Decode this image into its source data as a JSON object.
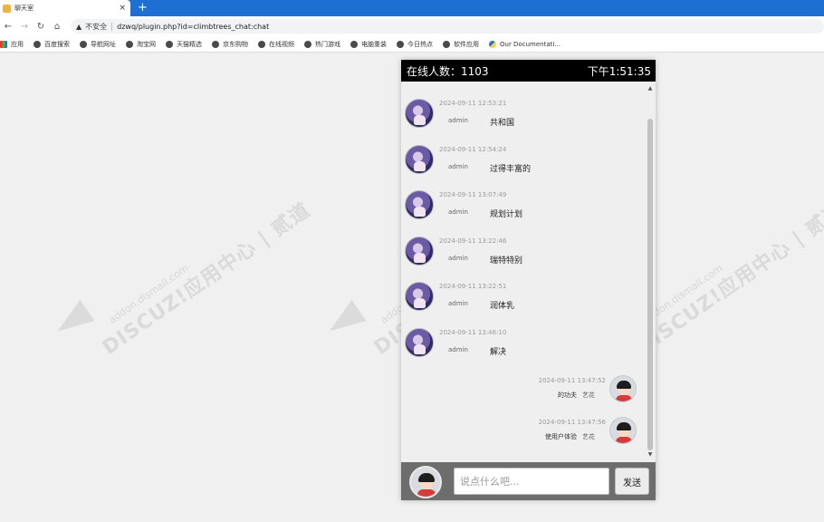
{
  "browser": {
    "tab_title": "聊天室",
    "tab_close": "×",
    "new_tab": "+",
    "back": "←",
    "forward": "→",
    "reload": "↻",
    "home": "⌂",
    "insecure_label": "不安全",
    "url": "dzwq/plugin.php?id=climbtrees_chat:chat",
    "bookmarks": [
      {
        "label": "应用",
        "icon": "apps-icon"
      },
      {
        "label": "百度搜索",
        "icon": "globe-icon"
      },
      {
        "label": "导航网址",
        "icon": "globe-icon"
      },
      {
        "label": "淘宝网",
        "icon": "globe-icon"
      },
      {
        "label": "天猫精选",
        "icon": "globe-icon"
      },
      {
        "label": "京东购物",
        "icon": "globe-icon"
      },
      {
        "label": "在线视频",
        "icon": "globe-icon"
      },
      {
        "label": "热门游戏",
        "icon": "globe-icon"
      },
      {
        "label": "电脑重装",
        "icon": "globe-icon"
      },
      {
        "label": "今日热点",
        "icon": "globe-icon"
      },
      {
        "label": "软件应用",
        "icon": "globe-icon"
      },
      {
        "label": "Our Documentati...",
        "icon": "python-icon"
      }
    ]
  },
  "watermark": {
    "brand": "DISCUZ!应用中心 | 贰道",
    "site": "addon.dismall.com"
  },
  "chat": {
    "online_label": "在线人数：1103",
    "clock": "下午1:51:35",
    "messages_in": [
      {
        "time": "2024-09-11 12:53:21",
        "name": "admin",
        "text": "共和国"
      },
      {
        "time": "2024-09-11 12:54:24",
        "name": "admin",
        "text": "过得丰富的"
      },
      {
        "time": "2024-09-11 13:07:49",
        "name": "admin",
        "text": "规划计划"
      },
      {
        "time": "2024-09-11 13:22:46",
        "name": "admin",
        "text": "瑞特特别"
      },
      {
        "time": "2024-09-11 13:22:51",
        "name": "admin",
        "text": "润体乳"
      },
      {
        "time": "2024-09-11 13:46:10",
        "name": "admin",
        "text": "解决"
      }
    ],
    "messages_out": [
      {
        "time": "2024-09-11 13:47:52",
        "text": "的功夫",
        "name": "艺花"
      },
      {
        "time": "2024-09-11 13:47:56",
        "text": "使用户体验",
        "name": "艺花"
      }
    ],
    "input_placeholder": "说点什么吧...",
    "send_label": "发送"
  }
}
